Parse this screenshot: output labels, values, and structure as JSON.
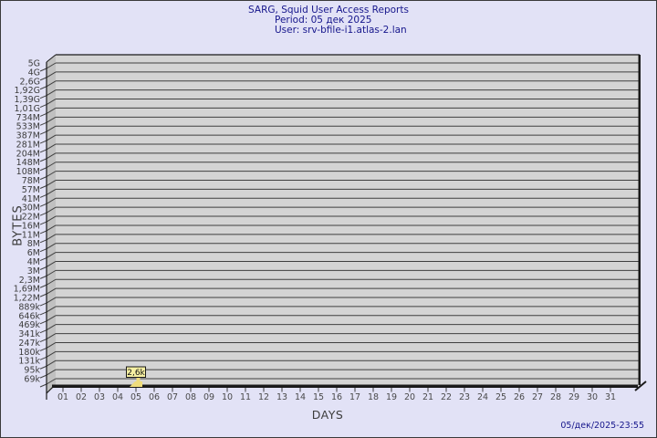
{
  "page": {
    "background": "#e2e2f6",
    "border_color": "#3a3a3a"
  },
  "title": {
    "line1": "SARG, Squid User Access Reports",
    "line2": "Period: 05 дек 2025",
    "line3": "User: srv-bfile-i1.atlas-2.lan",
    "color": "#16168c"
  },
  "axes": {
    "x_label": "DAYS",
    "y_label": "BYTES"
  },
  "footer": {
    "timestamp": "05/дек/2025-23:55"
  },
  "chart_data": {
    "type": "bar",
    "title": "SARG, Squid User Access Reports",
    "period": "05 дек 2025",
    "user": "srv-bfile-i1.atlas-2.lan",
    "xlabel": "DAYS",
    "ylabel": "BYTES",
    "scale": "logarithmic",
    "grid": true,
    "x_categories": [
      "01",
      "02",
      "03",
      "04",
      "05",
      "06",
      "07",
      "08",
      "09",
      "10",
      "11",
      "12",
      "13",
      "14",
      "15",
      "16",
      "17",
      "18",
      "19",
      "20",
      "21",
      "22",
      "23",
      "24",
      "25",
      "26",
      "27",
      "28",
      "29",
      "30",
      "31"
    ],
    "y_tick_labels": [
      "5G",
      "4G",
      "2,6G",
      "1,92G",
      "1,39G",
      "1,01G",
      "734M",
      "533M",
      "387M",
      "281M",
      "204M",
      "148M",
      "108M",
      "78M",
      "57M",
      "41M",
      "30M",
      "22M",
      "16M",
      "11M",
      "8M",
      "6M",
      "4M",
      "3M",
      "2,3M",
      "1,69M",
      "1,22M",
      "889k",
      "646k",
      "469k",
      "341k",
      "247k",
      "180k",
      "131k",
      "95k",
      "69k"
    ],
    "bars": [
      {
        "category": "05",
        "label": "2,6k",
        "value_bytes": 2600
      }
    ],
    "colors": {
      "plot_face": "#d4d4d4",
      "wall": "#c0c0c0",
      "gridline": "#3f3f3f",
      "edge": "#1a1a1a",
      "tick_text": "#3c3c3c",
      "day_text": "#4a4a4a",
      "bar": "#eedc7c",
      "bar_label_bg": "#f6f0a2",
      "bar_label_border": "#1a1a1a",
      "bar_label_text": "#111111"
    }
  }
}
